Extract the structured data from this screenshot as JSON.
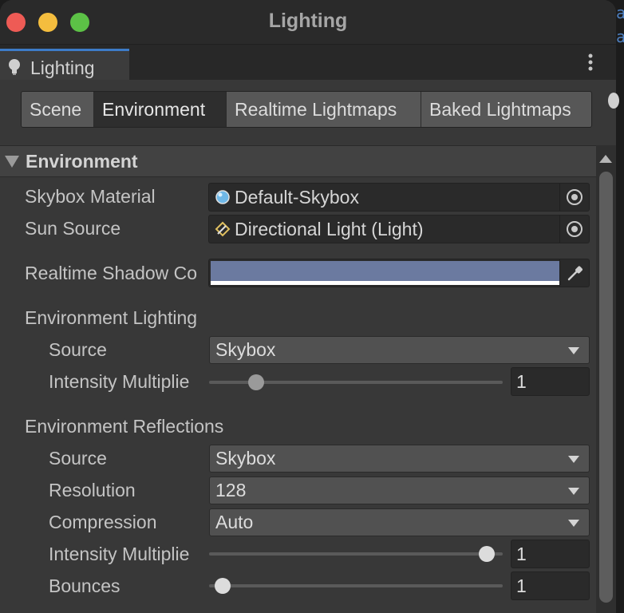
{
  "window": {
    "title": "Lighting"
  },
  "tab": {
    "label": "Lighting"
  },
  "toolbar": {
    "buttons": [
      "Scene",
      "Environment",
      "Realtime Lightmaps",
      "Baked Lightmaps"
    ],
    "active": "Environment"
  },
  "section": {
    "title": "Environment"
  },
  "fields": {
    "skybox_material": {
      "label": "Skybox Material",
      "value": "Default-Skybox"
    },
    "sun_source": {
      "label": "Sun Source",
      "value": "Directional Light (Light)"
    },
    "realtime_shadow": {
      "label": "Realtime Shadow Co",
      "color": "#6b7aa0"
    }
  },
  "environment_lighting": {
    "header": "Environment Lighting",
    "source": {
      "label": "Source",
      "value": "Skybox"
    },
    "intensity": {
      "label": "Intensity Multiplie",
      "value": "1",
      "slider_fraction": 0.14
    }
  },
  "environment_reflections": {
    "header": "Environment Reflections",
    "source": {
      "label": "Source",
      "value": "Skybox"
    },
    "resolution": {
      "label": "Resolution",
      "value": "128"
    },
    "compression": {
      "label": "Compression",
      "value": "Auto"
    },
    "intensity": {
      "label": "Intensity Multiplie",
      "value": "1",
      "slider_fraction": 0.97
    },
    "bounces": {
      "label": "Bounces",
      "value": "1",
      "slider_fraction": 0.02
    }
  },
  "colors": {
    "tab_accent": "#3d7cc8",
    "close": "#ee5b55",
    "minimize": "#f4bd3e",
    "maximize": "#5cc146",
    "panel_bg": "#383838"
  },
  "icons": {
    "tab": "lightbulb-icon",
    "menu": "kebab-menu-icon",
    "skybox": "material-sphere-icon",
    "sun": "light-icon",
    "picker": "object-picker-icon",
    "eyedropper": "eyedropper-icon",
    "fold": "foldout-arrow-icon"
  }
}
